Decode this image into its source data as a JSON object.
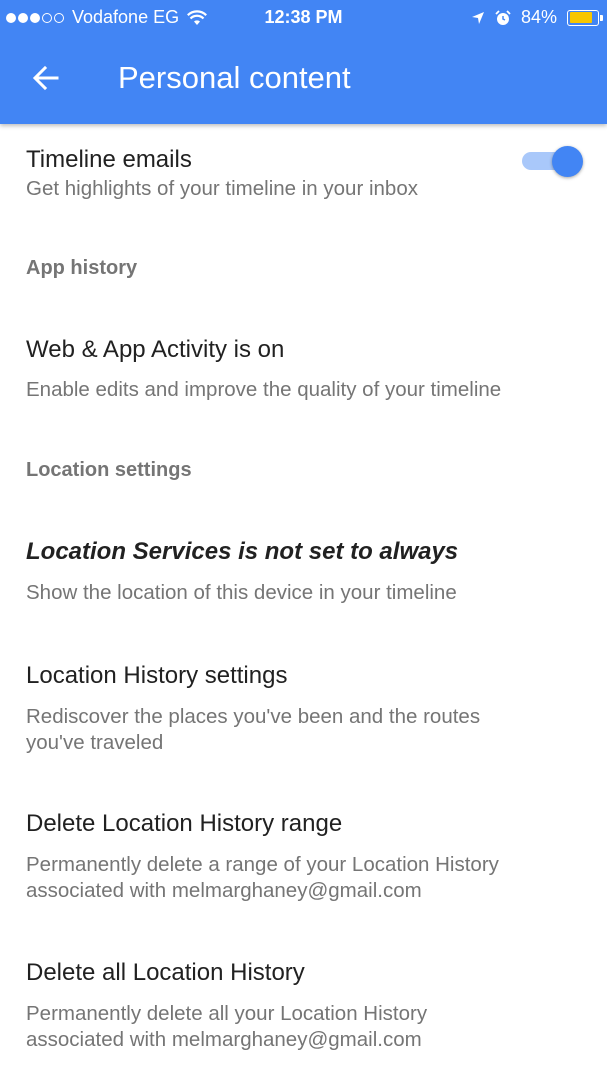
{
  "status_bar": {
    "carrier": "Vodafone EG",
    "time": "12:38 PM",
    "battery": "84%",
    "battery_level": 0.84,
    "signal_icon": "signal-dots-icon",
    "wifi_icon": "wifi-icon",
    "location_icon": "location-arrow-icon",
    "alarm_icon": "alarm-icon"
  },
  "appbar": {
    "title": "Personal content",
    "back_icon": "arrow-left-icon",
    "color": "#4285f4"
  },
  "timeline_emails": {
    "title": "Timeline emails",
    "subtitle": "Get highlights of your timeline in your inbox",
    "enabled": true
  },
  "sections": {
    "app_history": "App history",
    "location_settings": "Location settings"
  },
  "web_app_activity": {
    "title": "Web & App Activity is on",
    "subtitle": "Enable edits and improve the quality of your timeline"
  },
  "location_services": {
    "title": "Location Services is not set to always",
    "subtitle": "Show the location of this device in your timeline"
  },
  "location_history_settings": {
    "title": "Location History settings",
    "subtitle_line1": "Rediscover the places you've been and the routes",
    "subtitle_line2": "you've traveled"
  },
  "delete_range": {
    "title": "Delete Location History range",
    "subtitle_line1": "Permanently delete a range of your Location History",
    "subtitle_line2": "associated with melmarghaney@gmail.com"
  },
  "delete_all": {
    "title": "Delete all Location History",
    "subtitle_line1": "Permanently delete all your Location History",
    "subtitle_line2": "associated with melmarghaney@gmail.com"
  }
}
